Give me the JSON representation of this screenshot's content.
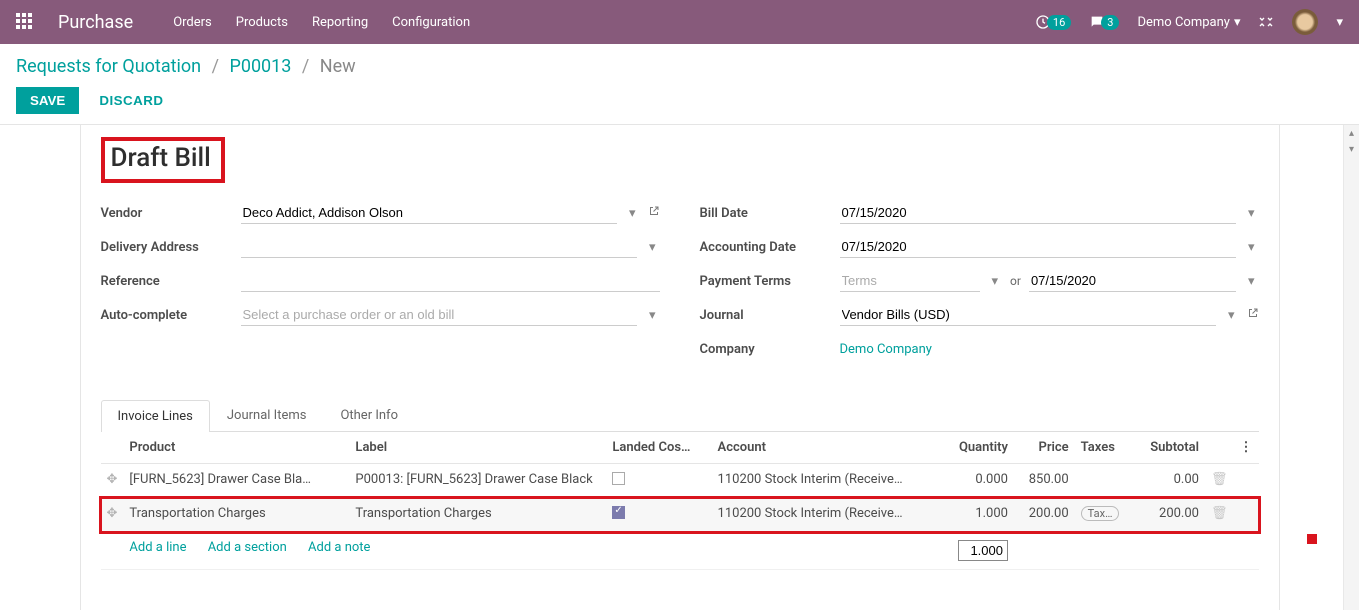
{
  "nav": {
    "app": "Purchase",
    "links": [
      "Orders",
      "Products",
      "Reporting",
      "Configuration"
    ],
    "clock_count": "16",
    "chat_count": "3",
    "company": "Demo Company"
  },
  "breadcrumb": {
    "a": "Requests for Quotation",
    "b": "P00013",
    "c": "New"
  },
  "actions": {
    "save": "SAVE",
    "discard": "DISCARD"
  },
  "title": "Draft Bill",
  "form": {
    "left": {
      "vendor_label": "Vendor",
      "vendor_value": "Deco Addict, Addison Olson",
      "delivery_label": "Delivery Address",
      "reference_label": "Reference",
      "autocomplete_label": "Auto-complete",
      "autocomplete_placeholder": "Select a purchase order or an old bill"
    },
    "right": {
      "billdate_label": "Bill Date",
      "billdate_value": "07/15/2020",
      "acctdate_label": "Accounting Date",
      "acctdate_value": "07/15/2020",
      "terms_label": "Payment Terms",
      "terms_placeholder": "Terms",
      "terms_or": "or",
      "terms_date": "07/15/2020",
      "journal_label": "Journal",
      "journal_value": "Vendor Bills (USD)",
      "company_label": "Company",
      "company_value": "Demo Company"
    }
  },
  "tabs": [
    "Invoice Lines",
    "Journal Items",
    "Other Info"
  ],
  "table": {
    "headers": {
      "product": "Product",
      "label": "Label",
      "landed": "Landed Cos…",
      "account": "Account",
      "qty": "Quantity",
      "price": "Price",
      "taxes": "Taxes",
      "subtotal": "Subtotal"
    },
    "rows": [
      {
        "product": "[FURN_5623] Drawer Case Bla…",
        "label": "P00013: [FURN_5623] Drawer Case Black",
        "landed": false,
        "account": "110200 Stock Interim (Receive…",
        "qty": "0.000",
        "price": "850.00",
        "taxes": "",
        "subtotal": "0.00"
      },
      {
        "product": "Transportation Charges",
        "label": "Transportation Charges",
        "landed": true,
        "account": "110200 Stock Interim (Receive…",
        "qty": "1.000",
        "price": "200.00",
        "taxes": "Tax…",
        "subtotal": "200.00"
      }
    ],
    "footer_qty": "1.000",
    "add_line": "Add a line",
    "add_section": "Add a section",
    "add_note": "Add a note"
  }
}
